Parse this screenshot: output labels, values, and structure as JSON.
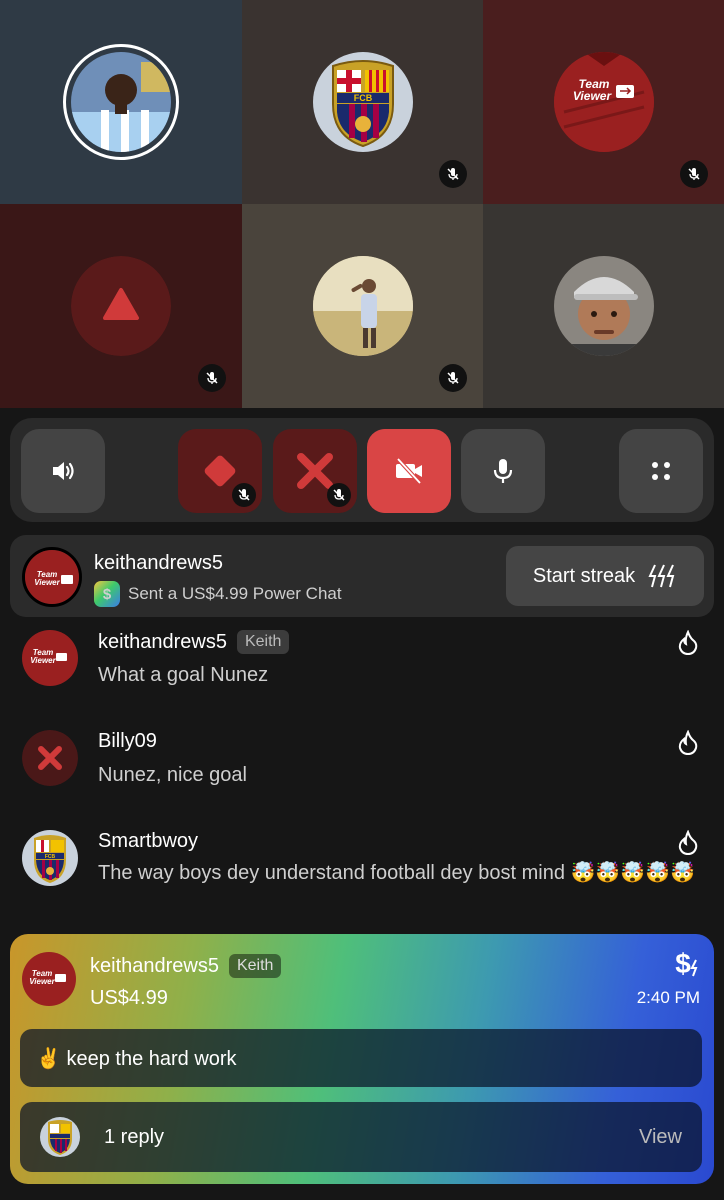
{
  "participants": [
    {
      "name": "participant-argentina-player",
      "muted": false,
      "speaking": true
    },
    {
      "name": "participant-fcb",
      "crest_text": "FCB",
      "muted": true
    },
    {
      "name": "participant-manutd-jersey",
      "sponsor": "TeamViewer",
      "muted": true
    },
    {
      "name": "participant-red-triangle",
      "muted": true
    },
    {
      "name": "participant-person-outdoor",
      "muted": true
    },
    {
      "name": "participant-person-cap",
      "muted": false
    }
  ],
  "controls": {
    "speaker_icon": "speaker-icon",
    "diamond_icon": "red-diamond-icon",
    "x_icon": "red-x-icon",
    "camera_off_icon": "video-off-icon",
    "mic_icon": "microphone-icon",
    "more_icon": "grid-dots-icon"
  },
  "power_banner": {
    "username": "keithandrews5",
    "subtitle": "Sent a US$4.99 Power Chat",
    "button": "Start streak"
  },
  "messages": [
    {
      "username": "keithandrews5",
      "tag": "Keith",
      "text": "What a goal Nunez"
    },
    {
      "username": "Billy09",
      "tag": "",
      "text": "Nunez, nice goal"
    },
    {
      "username": "Smartbwoy",
      "tag": "",
      "text": "The way boys dey understand football dey bost mind 🤯🤯🤯🤯🤯"
    }
  ],
  "power_chat": {
    "username": "keithandrews5",
    "tag": "Keith",
    "amount": "US$4.99",
    "time": "2:40 PM",
    "message": "✌️ keep the hard work",
    "reply_count": "1 reply",
    "view_label": "View"
  },
  "colors": {
    "accent_red": "#d94545",
    "background": "#161616",
    "panel": "#2a2a2a"
  }
}
